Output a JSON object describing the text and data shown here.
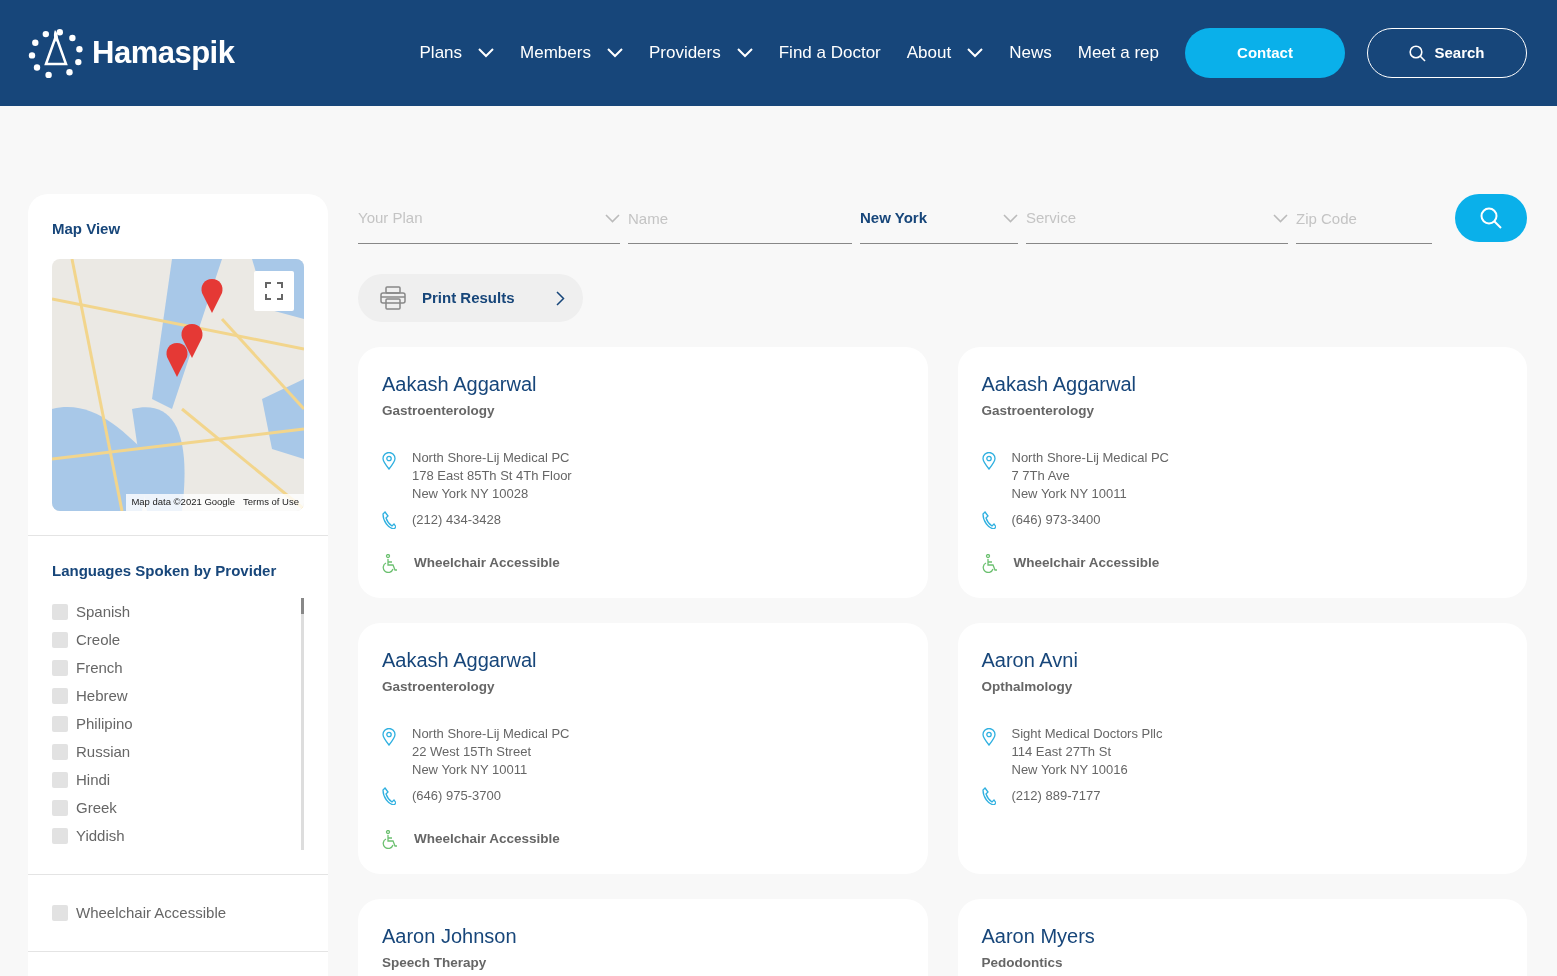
{
  "brand": {
    "name": "Hamaspik"
  },
  "nav": [
    {
      "label": "Plans",
      "dropdown": true
    },
    {
      "label": "Members",
      "dropdown": true
    },
    {
      "label": "Providers",
      "dropdown": true
    },
    {
      "label": "Find a Doctor",
      "dropdown": false
    },
    {
      "label": "About",
      "dropdown": true
    },
    {
      "label": "News",
      "dropdown": false
    },
    {
      "label": "Meet a rep",
      "dropdown": false
    }
  ],
  "contact_button": "Contact",
  "search_button": "Search",
  "sidebar": {
    "map_title": "Map View",
    "map": {
      "kind": "picture",
      "attribution": "Map data ©2021 Google",
      "terms": "Terms of Use"
    },
    "languages_title": "Languages Spoken by Provider",
    "languages": [
      {
        "label": "Spanish",
        "checked": false
      },
      {
        "label": "Creole",
        "checked": false
      },
      {
        "label": "French",
        "checked": false
      },
      {
        "label": "Hebrew",
        "checked": false
      },
      {
        "label": "Philipino",
        "checked": false
      },
      {
        "label": "Russian",
        "checked": false
      },
      {
        "label": "Hindi",
        "checked": false
      },
      {
        "label": "Greek",
        "checked": false
      },
      {
        "label": "Yiddish",
        "checked": false
      }
    ],
    "accessibility": [
      {
        "label": "Wheelchair Accessible",
        "checked": false
      }
    ]
  },
  "filters": [
    {
      "kind": "select",
      "placeholder": "Your Plan"
    },
    {
      "kind": "input",
      "placeholder": "Name"
    },
    {
      "kind": "select",
      "value": "New York"
    },
    {
      "kind": "select",
      "placeholder": "Service"
    },
    {
      "kind": "input",
      "placeholder": "Zip Code"
    }
  ],
  "print_button": "Print Results",
  "providers": [
    {
      "name": "Aakash Aggarwal",
      "specialty": "Gastroenterology",
      "address": [
        "North Shore-Lij Medical PC",
        "178 East 85Th St 4Th Floor",
        "New York NY 10028"
      ],
      "phone": "(212) 434-3428",
      "accessibility": "Wheelchair Accessible"
    },
    {
      "name": "Aakash Aggarwal",
      "specialty": "Gastroenterology",
      "address": [
        "North Shore-Lij Medical PC",
        "7 7Th Ave",
        "New York NY 10011"
      ],
      "phone": "(646) 973-3400",
      "accessibility": "Wheelchair Accessible"
    },
    {
      "name": "Aakash Aggarwal",
      "specialty": "Gastroenterology",
      "address": [
        "North Shore-Lij Medical PC",
        "22 West 15Th Street",
        "New York NY 10011"
      ],
      "phone": "(646) 975-3700",
      "accessibility": "Wheelchair Accessible"
    },
    {
      "name": "Aaron Avni",
      "specialty": "Opthalmology",
      "address": [
        "Sight Medical Doctors Pllc",
        "114 East 27Th St",
        "New York NY 10016"
      ],
      "phone": "(212) 889-7177"
    },
    {
      "name": "Aaron Johnson",
      "specialty": "Speech Therapy"
    },
    {
      "name": "Aaron Myers",
      "specialty": "Pedodontics"
    }
  ]
}
